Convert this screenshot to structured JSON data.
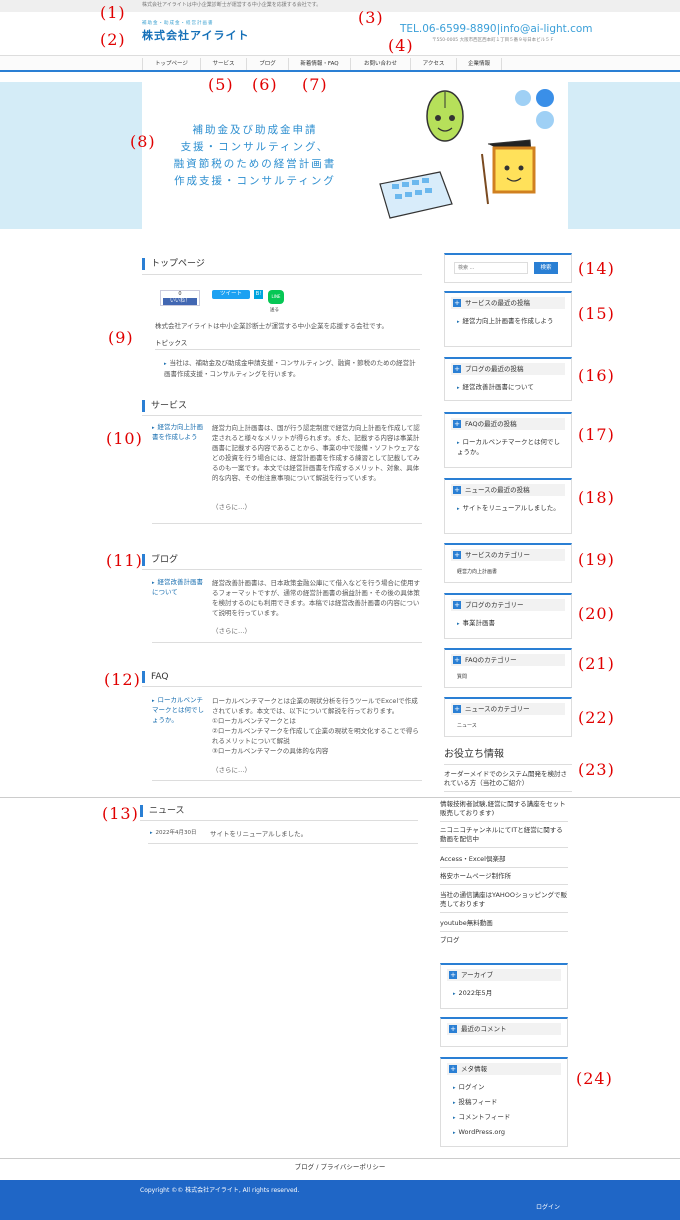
{
  "header": {
    "topbar": "株式会社アイライトは中小企業診断士が運営する中小企業を応援する会社です。",
    "logo_sub": "補助金・助成金・経営計画書",
    "logo": "株式会社アイライト",
    "contact": "TEL.06-6599-8890|info@ai-light.com",
    "address": "〒550-0005 大阪市西区西本町１丁目５番９号日本ビル５Ｆ"
  },
  "nav": [
    "トップページ",
    "サービス",
    "ブログ",
    "新着情報・FAQ",
    "お問い合わせ",
    "アクセス",
    "企業情報"
  ],
  "hero": {
    "lines": [
      "補助金及び助成金申請",
      "支援・コンサルティング、",
      "融資節税のための経営計画書",
      "作成支援・コンサルティング"
    ]
  },
  "annotations": [
    "(1)",
    "(2)",
    "(3)",
    "(4)",
    "(5)",
    "(6)",
    "(7)",
    "(8)",
    "(9)",
    "(10)",
    "(11)",
    "(12)",
    "(13)",
    "(14)",
    "(15)",
    "(16)",
    "(17)",
    "(18)",
    "(19)",
    "(20)",
    "(21)",
    "(22)",
    "(23)",
    "(24)"
  ],
  "main": {
    "top_title": "トップページ",
    "social": {
      "fb_count": "0",
      "fb_like": "いいね！",
      "tweet": "ツイート",
      "hatena": "B!",
      "line": "LINE",
      "line_save": "送る"
    },
    "intro": "株式会社アイライトは中小企業診断士が運営する中小企業を応援する会社です。",
    "topics_title": "トピックス",
    "topics_text": "当社は、補助金及び助成金申請支援・コンサルティング、融資・節税のための経営計画書作成支援・コンサルティングを行います。",
    "service": {
      "title": "サービス",
      "item": "経営力向上計画書を作成しよう",
      "text": "経営力向上計画書は、国が行う認定制度で経営力向上計画を作成して認定されると様々なメリットが得られます。また、記載する内容は事業計画書に記載する内容であることから、事業の中で設備・ソフトウェアなどの投資を行う場合には、経営計画書を作成する練習として記載してみるのも一案です。本文では経営計画書を作成するメリット、対象、具体的な内容、その他注意事項について解説を行っています。",
      "more": "（さらに…）"
    },
    "blog": {
      "title": "ブログ",
      "item": "経営改善計画書について",
      "text": "経営改善計画書は、日本政策金融公庫にて借入などを行う場合に使用するフォーマットですが、通常の経営計画書の損益計画・その後の具体策を検討するのにも利用できます。本稿では経営改善計画書の内容について説明を行っています。",
      "more": "（さらに…）"
    },
    "faq": {
      "title": "FAQ",
      "item": "ローカルベンチマークとは何でしょうか。",
      "text1": "ローカルベンチマークとは企業の現状分析を行うツールでExcelで作成されています。本文では、以下について解説を行っております。",
      "text2": "①ローカルベンチマークとは",
      "text3": "②ローカルベンチマークを作成して企業の現状を明文化することで得られるメリットについて解説",
      "text4": "③ローカルベンチマークの具体的な内容",
      "more": "（さらに…）"
    },
    "news": {
      "title": "ニュース",
      "date": "2022年4月30日",
      "text": "サイトをリニューアルしました。"
    }
  },
  "sidebar": {
    "search_placeholder": "検索 ...",
    "search_button": "検索",
    "service_recent": {
      "title": "サービスの最近の投稿",
      "item": "経営力向上計画書を作成しよう"
    },
    "blog_recent": {
      "title": "ブログの最近の投稿",
      "item": "経営改善計画書について"
    },
    "faq_recent": {
      "title": "FAQの最近の投稿",
      "item": "ローカルベンチマークとは何でしょうか。"
    },
    "news_recent": {
      "title": "ニュースの最近の投稿",
      "item": "サイトをリニューアルしました。"
    },
    "service_cat": {
      "title": "サービスのカテゴリー",
      "item": "経営力向上計画書"
    },
    "blog_cat": {
      "title": "ブログのカテゴリー",
      "item": "事業計画書"
    },
    "faq_cat": {
      "title": "FAQのカテゴリー",
      "item": "質問"
    },
    "news_cat": {
      "title": "ニュースのカテゴリー",
      "item": "ニュース"
    },
    "useful_title": "お役立ち情報",
    "useful_links": [
      "オーダーメイドでのシステム開発を検討されている方（当社のご紹介）",
      "情報技術者試験,経営に関する講座をセット販売しております)",
      "ニコニコチャンネルにてITと経営に関する動画を配信中",
      "Access・Excel倶楽部",
      "格安ホームページ制作所",
      "当社の通信講座はYAHOOショッピングで販売しております",
      "youtube無料動画",
      "ブログ"
    ],
    "archive": {
      "title": "アーカイブ",
      "item": "2022年5月"
    },
    "comments_title": "最近のコメント",
    "meta": {
      "title": "メタ情報",
      "items": [
        "ログイン",
        "投稿フィード",
        "コメントフィード",
        "WordPress.org"
      ]
    }
  },
  "footer": {
    "links": "ブログ / プライバシーポリシー",
    "copyright": "Copyright ©© 株式会社アイライト, All rights reserved.",
    "login": "ログイン"
  }
}
